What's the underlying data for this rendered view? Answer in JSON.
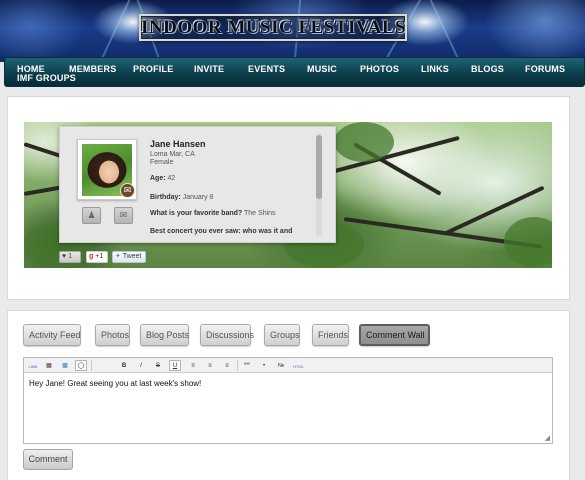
{
  "site": {
    "logo_text": "INDOOR MUSIC FESTIVALS"
  },
  "nav": {
    "home": "HOME",
    "imf_groups": "IMF GROUPS",
    "members": "MEMBERS",
    "profile": "PROFILE",
    "invite": "INVITE",
    "events": "EVENTS",
    "music": "MUSIC",
    "photos": "PHOTOS",
    "links": "LINKS",
    "blogs": "BLOGS",
    "forums": "FORUMS"
  },
  "profile": {
    "name": "Jane Hansen",
    "location": "Loma Mar, CA",
    "gender": "Female",
    "age_label": "Age:",
    "age_value": "42",
    "birthday_label": "Birthday:",
    "birthday_value": "January 8",
    "band_label": "What is your favorite band?",
    "band_value": "The Shins",
    "concert_label": "Best concert you ever saw: who was it and"
  },
  "social": {
    "like_count": "1",
    "gplus_label": "+1",
    "tweet_label": "Tweet"
  },
  "tabs": [
    {
      "label": "Activity Feed"
    },
    {
      "label": "Photos"
    },
    {
      "label": "Blog Posts"
    },
    {
      "label": "Discussions"
    },
    {
      "label": "Groups"
    },
    {
      "label": "Friends"
    },
    {
      "label": "Comment Wall"
    }
  ],
  "active_tab": "Comment Wall",
  "editor": {
    "text": "Hey Jane! Great seeing you at last week's show!",
    "toolbar": {
      "link": "LINK",
      "bold": "B",
      "italic": "I",
      "strike": "S",
      "underline": "U",
      "quote": "““",
      "html": "HTML"
    }
  },
  "comment_button": "Comment",
  "colors": {
    "nav_bg": "#0e3f4d",
    "active_tab_bg": "#9a9a9a",
    "page_bg": "#e9eaec"
  }
}
